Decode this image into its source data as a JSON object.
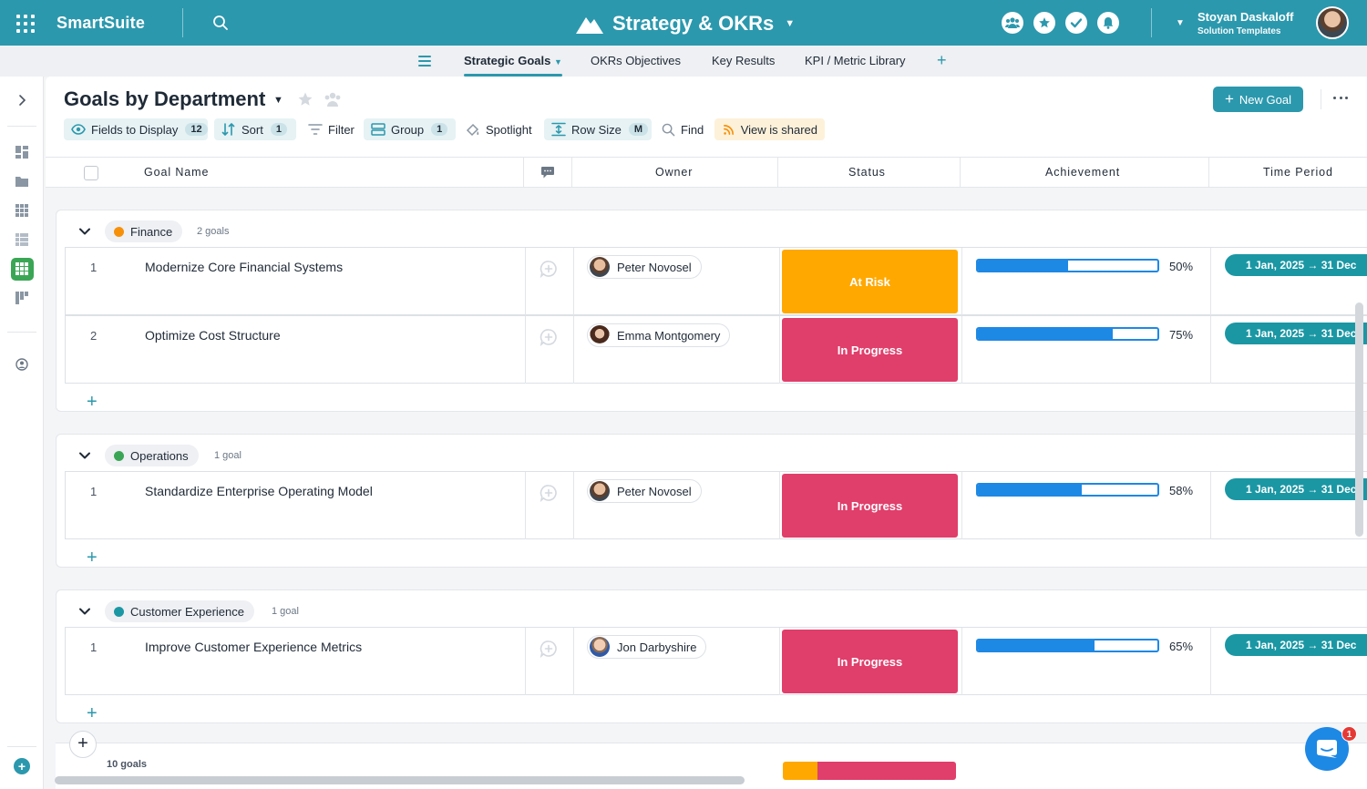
{
  "app": {
    "brand": "SmartSuite",
    "workspace": "Strategy & OKRs"
  },
  "user": {
    "name": "Stoyan Daskaloff",
    "subtitle": "Solution Templates"
  },
  "tabs": [
    {
      "label": "Strategic Goals",
      "active": true
    },
    {
      "label": "OKRs Objectives"
    },
    {
      "label": "Key Results"
    },
    {
      "label": "KPI / Metric Library"
    }
  ],
  "view": {
    "title": "Goals by Department",
    "new_button": "New Goal"
  },
  "toolbar": {
    "fields": {
      "label": "Fields to Display",
      "count": "12"
    },
    "sort": {
      "label": "Sort",
      "count": "1"
    },
    "filter": {
      "label": "Filter"
    },
    "group": {
      "label": "Group",
      "count": "1"
    },
    "spotlight": {
      "label": "Spotlight"
    },
    "row_size": {
      "label": "Row Size",
      "count": "M"
    },
    "find": {
      "label": "Find"
    },
    "shared": {
      "label": "View is shared"
    }
  },
  "columns": {
    "goal_name": "Goal Name",
    "owner": "Owner",
    "status": "Status",
    "achievement": "Achievement",
    "time_period": "Time Period"
  },
  "groups": [
    {
      "name": "Finance",
      "color": "#f79009",
      "count_label": "2 goals",
      "rows": [
        {
          "num": "1",
          "name": "Modernize Core Financial Systems",
          "owner": "Peter Novosel",
          "status": "At Risk",
          "status_color": "#ffa800",
          "achievement": 0.5,
          "achievement_label": "50%",
          "period": "1 Jan, 2025 → 31 Dec"
        },
        {
          "num": "2",
          "name": "Optimize Cost Structure",
          "owner": "Emma Montgomery",
          "status": "In Progress",
          "status_color": "#e03e6b",
          "achievement": 0.75,
          "achievement_label": "75%",
          "period": "1 Jan, 2025 → 31 Dec"
        }
      ]
    },
    {
      "name": "Operations",
      "color": "#3aa655",
      "count_label": "1 goal",
      "rows": [
        {
          "num": "1",
          "name": "Standardize Enterprise Operating Model",
          "owner": "Peter Novosel",
          "status": "In Progress",
          "status_color": "#e03e6b",
          "achievement": 0.58,
          "achievement_label": "58%",
          "period": "1 Jan, 2025 → 31 Dec"
        }
      ]
    },
    {
      "name": "Customer Experience",
      "color": "#1b97a4",
      "count_label": "1 goal",
      "rows": [
        {
          "num": "1",
          "name": "Improve Customer Experience Metrics",
          "owner": "Jon Darbyshire",
          "status": "In Progress",
          "status_color": "#e03e6b",
          "achievement": 0.65,
          "achievement_label": "65%",
          "period": "1 Jan, 2025 → 31 Dec"
        }
      ]
    }
  ],
  "footer": {
    "total": "10 goals",
    "status_summary": [
      {
        "status": "At Risk",
        "share": 0.2,
        "color": "#ffa800"
      },
      {
        "status": "In Progress",
        "share": 0.8,
        "color": "#e03e6b"
      }
    ]
  },
  "chat": {
    "badge": "1"
  },
  "colors": {
    "primary": "#2b98ad",
    "accent_green": "#3aa655",
    "progress_blue": "#1e88e5"
  }
}
